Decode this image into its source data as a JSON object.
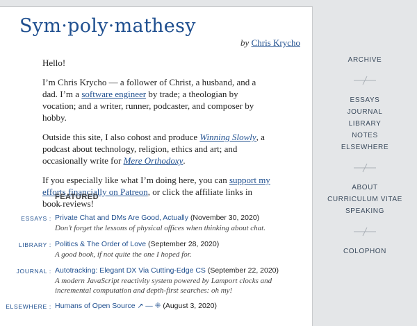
{
  "site": {
    "title": "Sym·poly·mathesy",
    "by_label": "by",
    "author": "Chris Krycho"
  },
  "intro": {
    "hello": "Hello!",
    "p1_start": "I’m Chris Krycho — a follower of Christ, a husband, and a dad. I’m a ",
    "p1_link": "software engineer",
    "p1_end": " by trade; a theologian by vocation; and a writer, runner, podcaster, and composer by hobby.",
    "p2_start": "Outside this site, I also cohost and produce ",
    "p2_link1": "Winning Slowly",
    "p2_mid": ", a podcast about technology, religion, ethics and art; and occasionally write for ",
    "p2_link2": "Mere Orthodoxy",
    "p2_end": ".",
    "p3_start": "If you especially like what I’m doing here, you can ",
    "p3_link": "support my efforts financially on Patreon",
    "p3_end": ", or click the affiliate links in book reviews!"
  },
  "featured": {
    "heading": "FEATURED",
    "items": [
      {
        "category": "ESSAYS :",
        "title": "Private Chat and DMs Are Good, Actually",
        "date": "(November 30, 2020)",
        "desc": "Don’t forget the lessons of physical offices when thinking about chat."
      },
      {
        "category": "LIBRARY :",
        "title": "Politics & The Order of Love",
        "date": "(September 28, 2020)",
        "desc": "A good book, if not quite the one I hoped for."
      },
      {
        "category": "JOURNAL :",
        "title": "Autotracking: Elegant DX Via Cutting-Edge CS",
        "date": "(September 22, 2020)",
        "desc": "A modern JavaScript reactivity system powered by Lamport clocks and incremental computation and depth-first searches: oh my!"
      },
      {
        "category": "ELSEWHERE :",
        "title": "Humans of Open Source",
        "title_suffix": " ↗ — ⁜",
        "date": "(August 3, 2020)",
        "desc": ""
      }
    ]
  },
  "nav": {
    "group1": [
      "ARCHIVE"
    ],
    "group2": [
      "ESSAYS",
      "JOURNAL",
      "LIBRARY",
      "NOTES",
      "ELSEWHERE"
    ],
    "group3": [
      "ABOUT",
      "CURRICULUM VITAE",
      "SPEAKING"
    ],
    "group4": [
      "COLOPHON"
    ]
  },
  "colors": {
    "link": "#1f4f8f",
    "sidebar_bg": "#e4e6e8",
    "sidebar_text": "#3a4a5c"
  }
}
